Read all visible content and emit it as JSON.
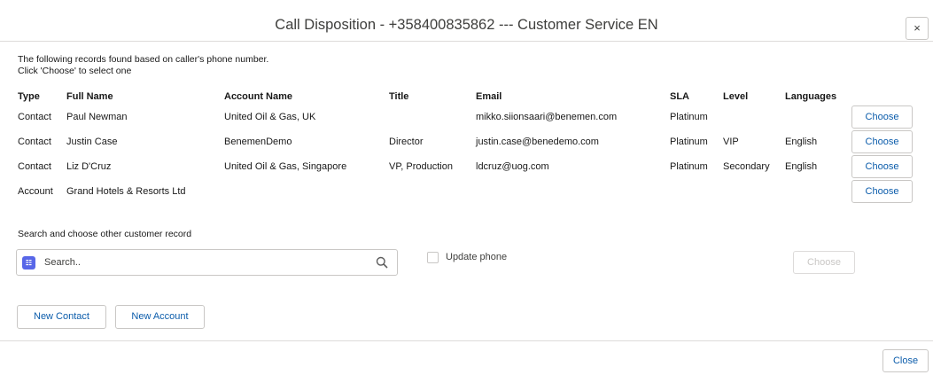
{
  "modal": {
    "title": "Call Disposition - +358400835862 --- Customer Service EN",
    "close_icon": "×"
  },
  "intro": {
    "line1": "The following records found based on caller's phone number.",
    "line2": "Click 'Choose' to select one"
  },
  "table": {
    "headers": {
      "type": "Type",
      "full_name": "Full Name",
      "account_name": "Account Name",
      "title": "Title",
      "email": "Email",
      "sla": "SLA",
      "level": "Level",
      "languages": "Languages"
    },
    "rows": [
      {
        "type": "Contact",
        "full_name": "Paul Newman",
        "account_name": "United Oil & Gas, UK",
        "title": "",
        "email": "mikko.siionsaari@benemen.com",
        "sla": "Platinum",
        "level": "",
        "languages": "",
        "action": "Choose"
      },
      {
        "type": "Contact",
        "full_name": "Justin Case",
        "account_name": "BenemenDemo",
        "title": "Director",
        "email": "justin.case@benedemo.com",
        "sla": "Platinum",
        "level": "VIP",
        "languages": "English",
        "action": "Choose"
      },
      {
        "type": "Contact",
        "full_name": "Liz D'Cruz",
        "account_name": "United Oil & Gas, Singapore",
        "title": "VP, Production",
        "email": "ldcruz@uog.com",
        "sla": "Platinum",
        "level": "Secondary",
        "languages": "English",
        "action": "Choose"
      },
      {
        "type": "Account",
        "full_name": "Grand Hotels & Resorts Ltd",
        "account_name": "",
        "title": "",
        "email": "",
        "sla": "",
        "level": "",
        "languages": "",
        "action": "Choose"
      }
    ]
  },
  "search": {
    "label": "Search and choose other customer record",
    "placeholder": "Search..",
    "badge_icon": "contact-icon",
    "search_icon": "search-icon"
  },
  "update_phone": {
    "label": "Update phone",
    "checked": false
  },
  "actions": {
    "choose_disabled": "Choose",
    "new_contact": "New Contact",
    "new_account": "New Account",
    "close": "Close"
  },
  "colors": {
    "button_text": "#0b5cab",
    "border": "#c9c7c5",
    "badge": "#5867e8"
  }
}
